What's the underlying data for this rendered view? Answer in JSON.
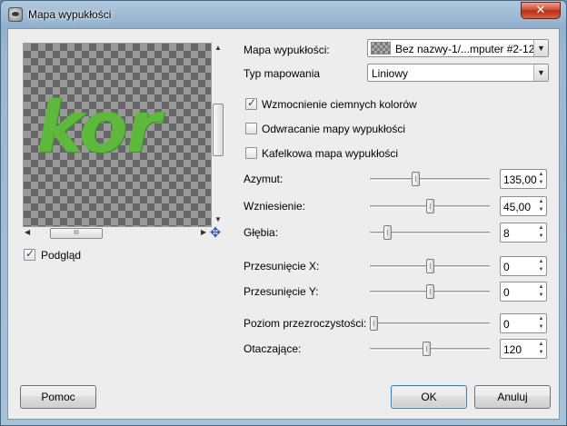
{
  "window": {
    "title": "Mapa wypukłości",
    "close_label": "✕"
  },
  "preview": {
    "sample_text": "kor",
    "checkbox_label": "Podgląd",
    "checked": true,
    "hscroll_thumb_glyph": "III",
    "up_arrow": "▲",
    "down_arrow": "▼",
    "left_arrow": "◀",
    "right_arrow": "▶",
    "nav_glyph": "✥"
  },
  "settings": {
    "bump_map_label": "Mapa wypukłości:",
    "bump_map_value": "Bez nazwy-1/...mputer #2-12",
    "map_type_label": "Typ mapowania",
    "map_type_value": "Liniowy",
    "drop_glyph": "▼",
    "options": [
      {
        "label": "Wzmocnienie ciemnych kolorów",
        "checked": true
      },
      {
        "label": "Odwracanie mapy wypukłości",
        "checked": false
      },
      {
        "label": "Kafelkowa mapa wypukłości",
        "checked": false
      }
    ]
  },
  "sliders": [
    {
      "label": "Azymut:",
      "value": "135,00",
      "fraction": 0.375
    },
    {
      "label": "Wzniesienie:",
      "value": "45,00",
      "fraction": 0.5
    },
    {
      "label": "Głębia:",
      "value": "8",
      "fraction": 0.12
    },
    {
      "label": "Przesunięcie X:",
      "value": "0",
      "fraction": 0.5
    },
    {
      "label": "Przesunięcie Y:",
      "value": "0",
      "fraction": 0.5
    },
    {
      "label": "Poziom przezroczystości:",
      "value": "0",
      "fraction": 0.0
    },
    {
      "label": "Otaczające:",
      "value": "120",
      "fraction": 0.47
    }
  ],
  "spin_arrows": {
    "up": "▲",
    "down": "▼"
  },
  "buttons": {
    "help": "Pomoc",
    "ok": "OK",
    "cancel": "Anuluj"
  }
}
